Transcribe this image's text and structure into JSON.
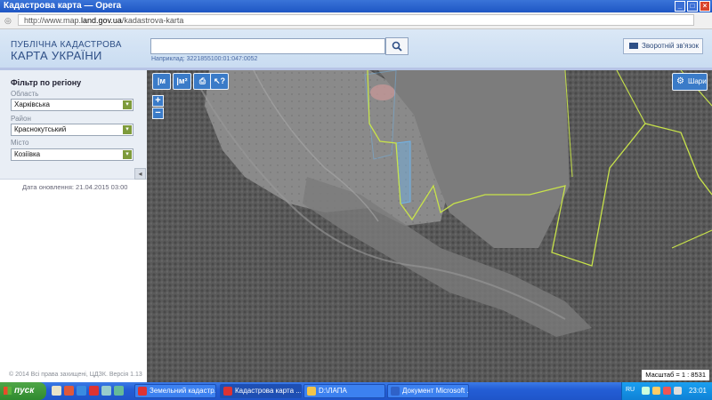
{
  "window": {
    "title": "Кадастрова карта — Opera"
  },
  "addressbar": {
    "url_prefix": "http://www.map.",
    "url_domain": "land.gov.ua",
    "url_suffix": "/kadastrova-karta"
  },
  "header": {
    "brand_line1": "ПУБЛІЧНА КАДАСТРОВА",
    "brand_line2": "КАРТА УКРАЇНИ",
    "search_value": "",
    "example_text": "Наприклад: 3221855100:01:047:0052",
    "feedback_label": "Зворотній зв'язок"
  },
  "sidebar": {
    "filter_title": "Фільтр по регіону",
    "region": {
      "label": "Область",
      "value": "Харківська"
    },
    "district": {
      "label": "Район",
      "value": "Краснокутський"
    },
    "city": {
      "label": "Місто",
      "value": "Козіївка"
    },
    "update_date": "Дата оновлення: 21.04.2015 03:00",
    "copyright": "© 2014 Всі права захищені, ЦДЗК. Версія 1.13"
  },
  "map": {
    "tools": [
      {
        "name": "measure-length",
        "glyph": "|м"
      },
      {
        "name": "measure-area",
        "glyph": "|м²"
      },
      {
        "name": "print",
        "glyph": "⎙"
      },
      {
        "name": "identify",
        "glyph": "↖?"
      }
    ],
    "zoom_in": "+",
    "zoom_out": "−",
    "layers_label": "Шари",
    "scale": "Масштаб = 1 : 8531",
    "boundary_color": "#c8e34a",
    "parcel_color": "#6fb3e8"
  },
  "taskbar": {
    "start_label": "пуск",
    "tasks": [
      {
        "label": "Земельний кадастр...",
        "icon_color": "#d33",
        "active": false
      },
      {
        "label": "Кадастрова карта ...",
        "icon_color": "#d33",
        "active": true
      },
      {
        "label": "D:\\ЛАПА",
        "icon_color": "#f2c44a",
        "active": false
      },
      {
        "label": "Документ Microsoft ...",
        "icon_color": "#2f62c8",
        "active": false
      }
    ],
    "tray_lang": "RU",
    "clock": "23:01"
  }
}
